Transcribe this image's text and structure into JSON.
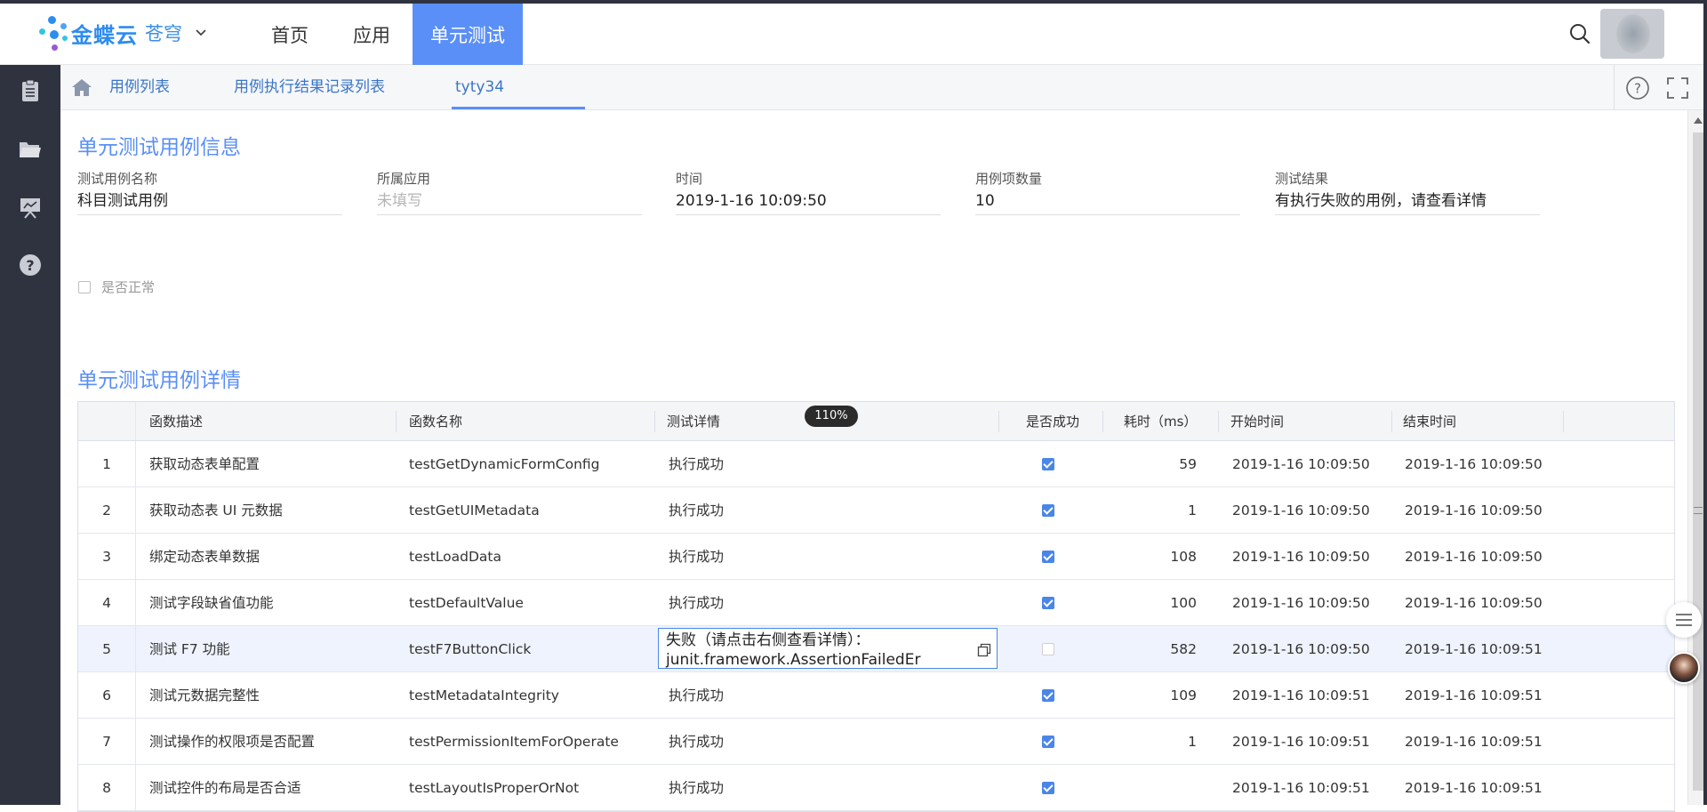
{
  "app": {
    "brand": "金蝶云",
    "brand_sub": "苍穹",
    "nav": [
      "首页",
      "应用",
      "单元测试"
    ],
    "nav_active": 2
  },
  "tabs": {
    "items": [
      "用例列表",
      "用例执行结果记录列表",
      "tyty34"
    ],
    "active": 2
  },
  "info": {
    "title": "单元测试用例信息",
    "fields": [
      {
        "label": "测试用例名称",
        "value": "科目测试用例",
        "placeholder": false
      },
      {
        "label": "所属应用",
        "value": "未填写",
        "placeholder": true
      },
      {
        "label": "时间",
        "value": "2019-1-16 10:09:50",
        "placeholder": false
      },
      {
        "label": "用例项数量",
        "value": "10",
        "placeholder": false
      },
      {
        "label": "测试结果",
        "value": "有执行失败的用例，请查看详情",
        "placeholder": false
      }
    ],
    "normal_checkbox_label": "是否正常",
    "normal_checked": false
  },
  "detail": {
    "title": "单元测试用例详情",
    "zoom_badge": "110%",
    "columns": [
      "函数描述",
      "函数名称",
      "测试详情",
      "是否成功",
      "耗时（ms）",
      "开始时间",
      "结束时间"
    ],
    "rows": [
      {
        "idx": "1",
        "desc": "获取动态表单配置",
        "func": "testGetDynamicFormConfig",
        "detail": "执行成功",
        "success": true,
        "ms": "59",
        "start": "2019-1-16 10:09:50",
        "end": "2019-1-16 10:09:50"
      },
      {
        "idx": "2",
        "desc": "获取动态表 UI 元数据",
        "func": "testGetUIMetadata",
        "detail": "执行成功",
        "success": true,
        "ms": "1",
        "start": "2019-1-16 10:09:50",
        "end": "2019-1-16 10:09:50"
      },
      {
        "idx": "3",
        "desc": "绑定动态表单数据",
        "func": "testLoadData",
        "detail": "执行成功",
        "success": true,
        "ms": "108",
        "start": "2019-1-16 10:09:50",
        "end": "2019-1-16 10:09:50"
      },
      {
        "idx": "4",
        "desc": "测试字段缺省值功能",
        "func": "testDefaultValue",
        "detail": "执行成功",
        "success": true,
        "ms": "100",
        "start": "2019-1-16 10:09:50",
        "end": "2019-1-16 10:09:50"
      },
      {
        "idx": "5",
        "desc": "测试 F7 功能",
        "func": "testF7ButtonClick",
        "detail": "失败（请点击右侧查看详情）：junit.framework.AssertionFailedEr",
        "success": false,
        "ms": "582",
        "start": "2019-1-16 10:09:50",
        "end": "2019-1-16 10:09:51"
      },
      {
        "idx": "6",
        "desc": "测试元数据完整性",
        "func": "testMetadataIntegrity",
        "detail": "执行成功",
        "success": true,
        "ms": "109",
        "start": "2019-1-16 10:09:51",
        "end": "2019-1-16 10:09:51"
      },
      {
        "idx": "7",
        "desc": "测试操作的权限项是否配置",
        "func": "testPermissionItemForOperate",
        "detail": "执行成功",
        "success": true,
        "ms": "1",
        "start": "2019-1-16 10:09:51",
        "end": "2019-1-16 10:09:51"
      },
      {
        "idx": "8",
        "desc": "测试控件的布局是否合适",
        "func": "testLayoutIsProperOrNot",
        "detail": "执行成功",
        "success": true,
        "ms": "",
        "start": "2019-1-16 10:09:51",
        "end": "2019-1-16 10:09:51"
      }
    ]
  },
  "colors": {
    "accent": "#5a8ff7",
    "sidebar": "#2f3340",
    "link": "#3a76c9"
  }
}
